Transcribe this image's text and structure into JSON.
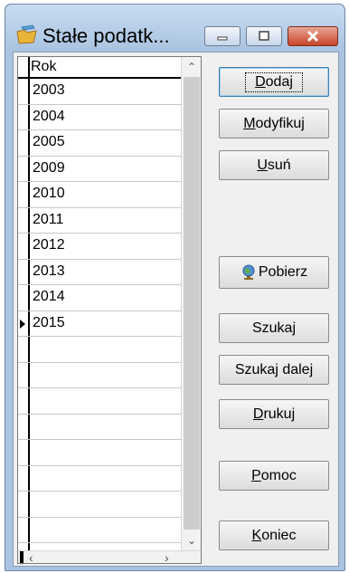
{
  "window": {
    "title": "Stałe podatk...",
    "controls": {
      "minimize": "minimize",
      "maximize": "maximize",
      "close": "close"
    }
  },
  "grid": {
    "header": "Rok",
    "rows": [
      "2003",
      "2004",
      "2005",
      "2009",
      "2010",
      "2011",
      "2012",
      "2013",
      "2014",
      "2015"
    ],
    "current_row": "2015"
  },
  "buttons": {
    "add": "Dodaj",
    "modify": "Modyfikuj",
    "delete": "Usuń",
    "download": "Pobierz",
    "search": "Szukaj",
    "search_next": "Szukaj dalej",
    "print": "Drukuj",
    "help": "Pomoc",
    "end": "Koniec"
  },
  "icons": {
    "app": "folder-pencil-icon",
    "download": "globe-icon"
  },
  "colors": {
    "titlebar": "#a9c3e0",
    "close_button": "#c9442a",
    "window_bg": "#f0f0f0"
  }
}
